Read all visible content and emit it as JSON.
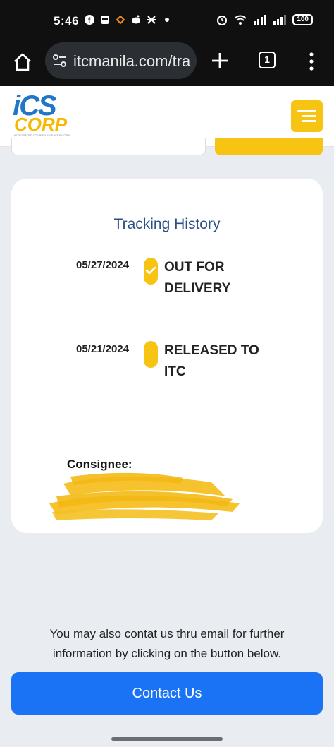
{
  "status_bar": {
    "time": "5:46",
    "battery": "100",
    "notification_icons": [
      "facebook-icon",
      "bus-icon",
      "app-icon",
      "reddit-icon",
      "x-app-icon",
      "dot-icon"
    ]
  },
  "browser": {
    "url": "itcmanila.com/tra",
    "tab_count": "1"
  },
  "header": {
    "logo_top": "iCS",
    "logo_bottom": "CORP",
    "logo_tagline": "INTEGRATED COURIER SERVICES CORP"
  },
  "tracking": {
    "title": "Tracking History",
    "entries": [
      {
        "date": "05/27/2024",
        "status_line1": "OUT FOR",
        "status_line2": "DELIVERY"
      },
      {
        "date": "05/21/2024",
        "status_line1": "RELEASED TO",
        "status_line2": "ITC"
      }
    ],
    "consignee_label": "Consignee:"
  },
  "footer": {
    "contact_text": "You may also contat us thru email for further information by clicking on the button below.",
    "contact_button": "Contact Us"
  },
  "colors": {
    "accent_yellow": "#f7c414",
    "title_blue": "#2e4f86",
    "button_blue": "#1a73f5",
    "background": "#e9ecf0"
  }
}
